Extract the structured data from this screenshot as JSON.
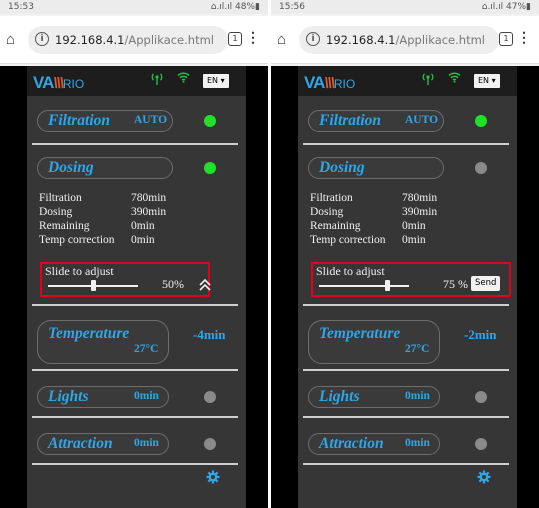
{
  "screens": [
    {
      "status": {
        "time": "15:53",
        "sys_icons": "⌂.ıl.ıl 48%▮"
      },
      "url": {
        "host": "192.168.4.1",
        "path": "/Applikace.html",
        "tabs": "1"
      },
      "header": {
        "lang": "EN ▾"
      },
      "filtration": {
        "title": "Filtration",
        "mode": "AUTO",
        "led": "on"
      },
      "dosing": {
        "title": "Dosing",
        "led": "on",
        "rows": [
          {
            "k": "Filtration",
            "v": "780min"
          },
          {
            "k": "Dosing",
            "v": "390min"
          },
          {
            "k": "Remaining",
            "v": "0min"
          },
          {
            "k": "Temp correction",
            "v": "0min"
          }
        ],
        "slider": {
          "label": "Slide to adjust",
          "percent_text": "50%",
          "value": 50,
          "control": "collapse"
        }
      },
      "temperature": {
        "title": "Temperature",
        "value": "27°C",
        "correction": "-4min"
      },
      "lights": {
        "title": "Lights",
        "value": "0min",
        "led": "off"
      },
      "attraction": {
        "title": "Attraction",
        "value": "0min",
        "led": "off"
      }
    },
    {
      "status": {
        "time": "15:56",
        "sys_icons": "⌂.ıl.ıl 47%▮"
      },
      "url": {
        "host": "192.168.4.1",
        "path": "/Applikace.html",
        "tabs": "1"
      },
      "header": {
        "lang": "EN ▾"
      },
      "filtration": {
        "title": "Filtration",
        "mode": "AUTO",
        "led": "on"
      },
      "dosing": {
        "title": "Dosing",
        "led": "off",
        "rows": [
          {
            "k": "Filtration",
            "v": "780min"
          },
          {
            "k": "Dosing",
            "v": "390min"
          },
          {
            "k": "Remaining",
            "v": "0min"
          },
          {
            "k": "Temp correction",
            "v": "0min"
          }
        ],
        "slider": {
          "label": "Slide to adjust",
          "percent_text": "75 %",
          "value": 75,
          "control": "send",
          "send_label": "Send"
        }
      },
      "temperature": {
        "title": "Temperature",
        "value": "27°C",
        "correction": "-2min"
      },
      "lights": {
        "title": "Lights",
        "value": "0min",
        "led": "off"
      },
      "attraction": {
        "title": "Attraction",
        "value": "0min",
        "led": "off"
      }
    }
  ],
  "brand": {
    "va": "VA",
    "slash": "\\\\\\",
    "rio": "RIO"
  },
  "colors": {
    "accent": "#2fa6e8",
    "led_on": "#22e02a",
    "led_off": "#8a8a8a",
    "highlight_box": "#e2001a"
  }
}
